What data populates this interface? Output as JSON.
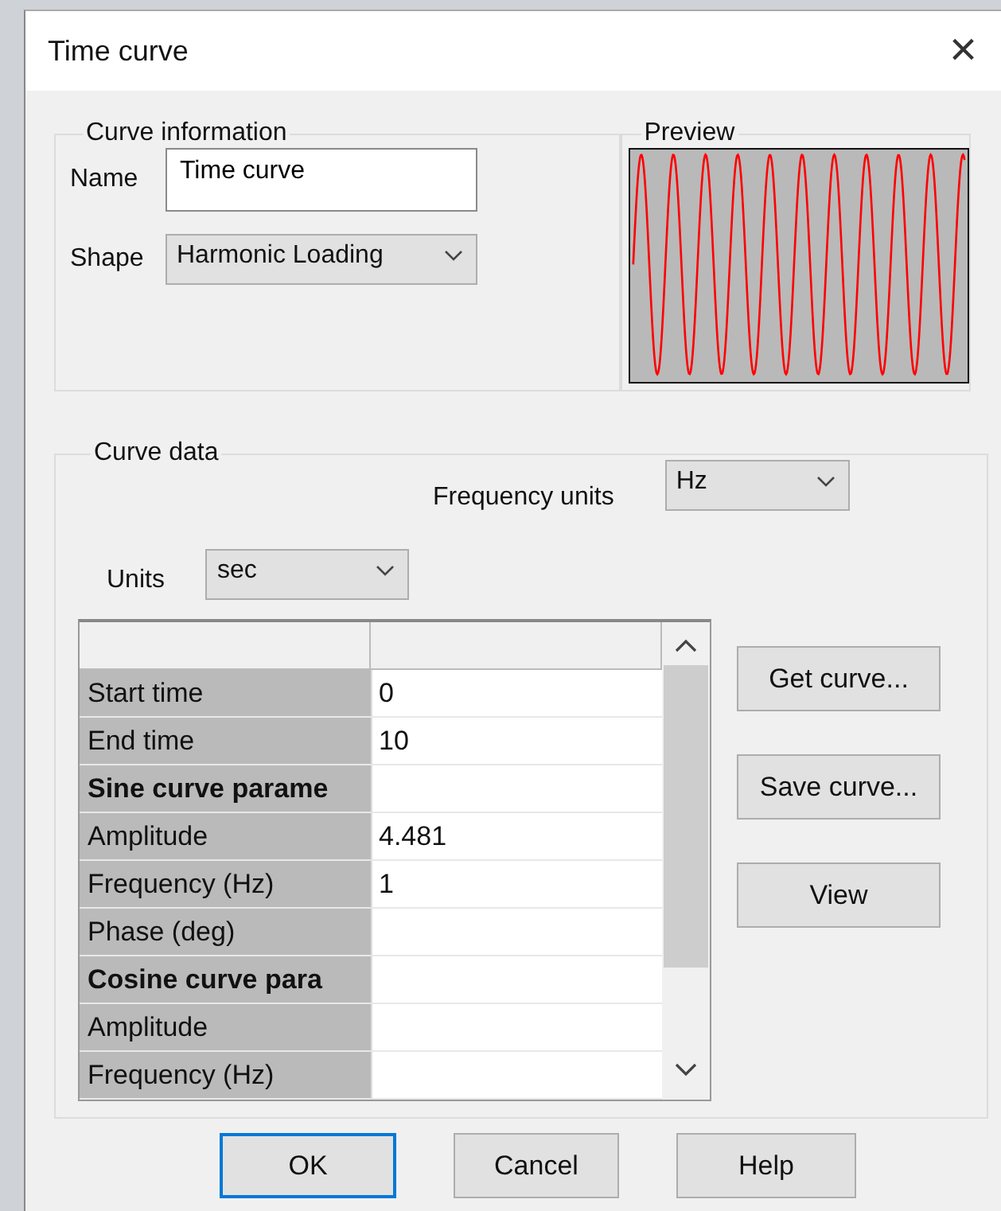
{
  "window": {
    "title": "Time curve",
    "close": "×"
  },
  "curve_information": {
    "title": "Curve information",
    "name_label": "Name",
    "name_value": "Time curve",
    "shape_label": "Shape",
    "shape_value": "Harmonic Loading"
  },
  "preview": {
    "title": "Preview"
  },
  "curve_data": {
    "title": "Curve data",
    "frequency_units_label": "Frequency units",
    "frequency_units_value": "Hz",
    "units_label": "Units",
    "units_value": "sec",
    "table": {
      "rows": [
        {
          "kind": "param",
          "label": "Start time",
          "value": "0"
        },
        {
          "kind": "param",
          "label": "End time",
          "value": "10"
        },
        {
          "kind": "section",
          "label": "Sine curve parame"
        },
        {
          "kind": "param",
          "label": "Amplitude",
          "value": "4.481"
        },
        {
          "kind": "param",
          "label": "Frequency (Hz)",
          "value": "1"
        },
        {
          "kind": "param",
          "label": "Phase (deg)"
        },
        {
          "kind": "section",
          "label": "Cosine curve para"
        },
        {
          "kind": "param",
          "label": "Amplitude"
        },
        {
          "kind": "param",
          "label": "Frequency (Hz)"
        }
      ]
    },
    "side_buttons": [
      "Get curve...",
      "Save curve...",
      "View"
    ]
  },
  "buttons": [
    {
      "label": "OK",
      "default": true
    },
    {
      "label": "Cancel",
      "default": false
    },
    {
      "label": "Help",
      "default": false
    }
  ]
}
